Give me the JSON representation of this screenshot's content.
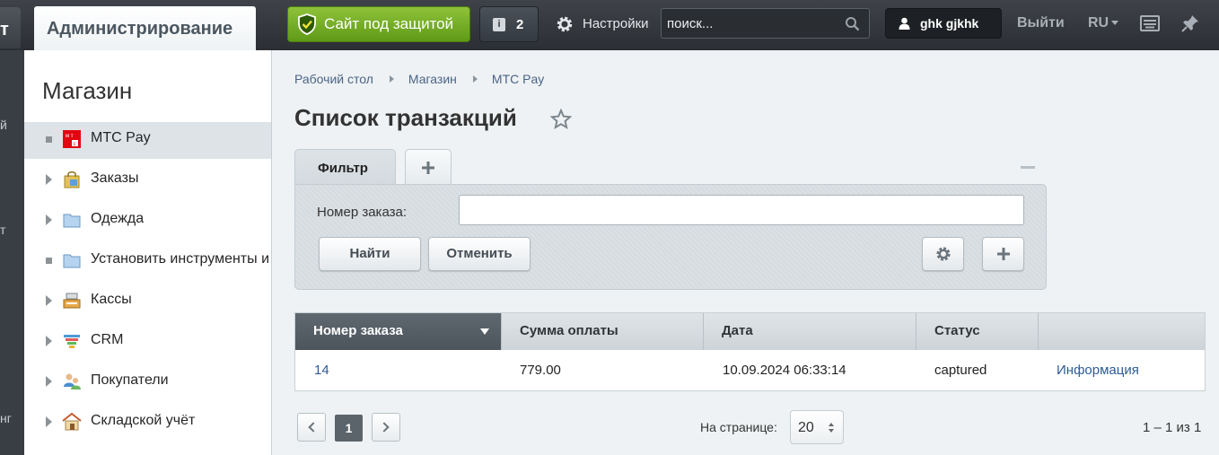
{
  "topbar": {
    "left_tab_fragment": "т",
    "admin_tab": "Администрирование",
    "secure_button": "Сайт под защитой",
    "notifications_count": "2",
    "settings": "Настройки",
    "search_placeholder": "поиск...",
    "user": "ghk gjkhk",
    "logout": "Выйти",
    "language": "RU"
  },
  "left_strip": [
    "й",
    "т",
    "нг"
  ],
  "sidebar": {
    "title": "Магазин",
    "items": [
      {
        "label": "МТС Pay",
        "icon": "mts-logo-icon",
        "active": true,
        "expandable": false
      },
      {
        "label": "Заказы",
        "icon": "shopping-bag-icon",
        "active": false,
        "expandable": true
      },
      {
        "label": "Одежда",
        "icon": "folder-icon",
        "active": false,
        "expandable": true
      },
      {
        "label": "Установить инструменты и",
        "icon": "folder-icon",
        "active": false,
        "expandable": false
      },
      {
        "label": "Кассы",
        "icon": "cash-register-icon",
        "active": false,
        "expandable": true
      },
      {
        "label": "CRM",
        "icon": "funnel-icon",
        "active": false,
        "expandable": true
      },
      {
        "label": "Покупатели",
        "icon": "users-icon",
        "active": false,
        "expandable": true
      },
      {
        "label": "Складской учёт",
        "icon": "warehouse-icon",
        "active": false,
        "expandable": true
      }
    ]
  },
  "breadcrumb": [
    "Рабочий стол",
    "Магазин",
    "МТС Pay"
  ],
  "page_title": "Список транзакций",
  "filter": {
    "tab_label": "Фильтр",
    "field_label": "Номер заказа:",
    "field_value": "",
    "find_button": "Найти",
    "cancel_button": "Отменить"
  },
  "table": {
    "columns": [
      "Номер заказа",
      "Сумма оплаты",
      "Дата",
      "Статус",
      ""
    ],
    "rows": [
      {
        "order": "14",
        "amount": "779.00",
        "date": "10.09.2024 06:33:14",
        "status": "captured",
        "action": "Информация"
      }
    ]
  },
  "pager": {
    "current_page": "1",
    "per_page_label": "На странице:",
    "per_page_value": "20",
    "total": "1 – 1 из 1"
  },
  "colors": {
    "secure_green": "#6aa61f",
    "link_blue": "#2d5b96",
    "topbar_dark": "#33373c"
  }
}
